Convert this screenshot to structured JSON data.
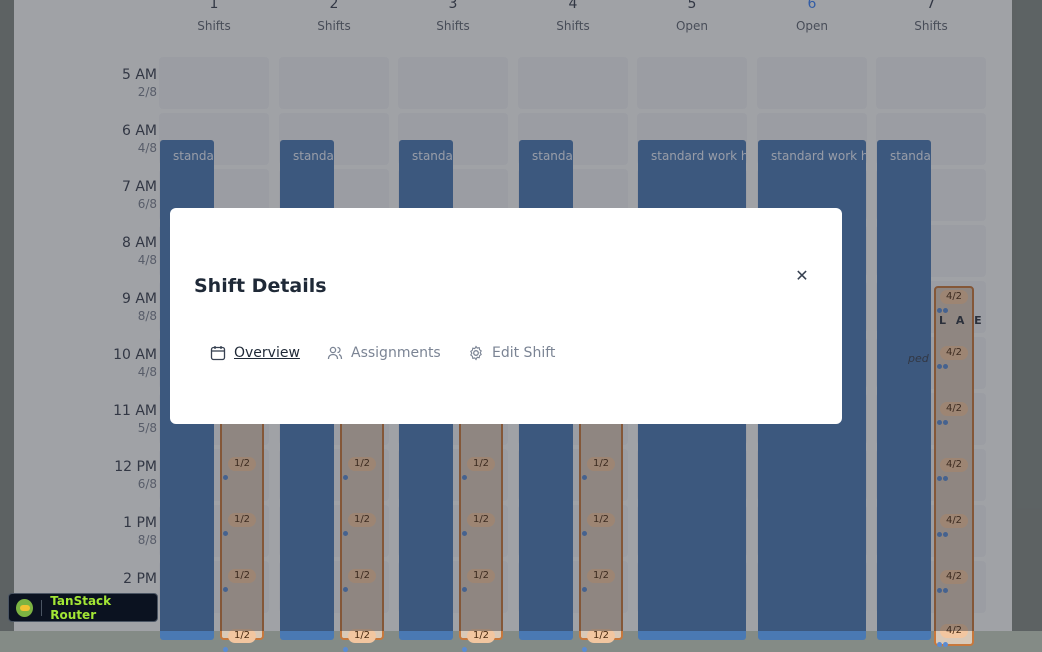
{
  "days": [
    {
      "num": "1",
      "sub": "Shifts",
      "today": false
    },
    {
      "num": "2",
      "sub": "Shifts",
      "today": false
    },
    {
      "num": "3",
      "sub": "Shifts",
      "today": false
    },
    {
      "num": "4",
      "sub": "Shifts",
      "today": false
    },
    {
      "num": "5",
      "sub": "Open",
      "today": false
    },
    {
      "num": "6",
      "sub": "Open",
      "today": true
    },
    {
      "num": "7",
      "sub": "Shifts",
      "today": false
    }
  ],
  "times": [
    {
      "time": "5 AM",
      "coverage": "2/8"
    },
    {
      "time": "6 AM",
      "coverage": "4/8"
    },
    {
      "time": "7 AM",
      "coverage": "6/8"
    },
    {
      "time": "8 AM",
      "coverage": "4/8"
    },
    {
      "time": "9 AM",
      "coverage": "8/8"
    },
    {
      "time": "10 AM",
      "coverage": "4/8"
    },
    {
      "time": "11 AM",
      "coverage": "5/8"
    },
    {
      "time": "12 PM",
      "coverage": "6/8"
    },
    {
      "time": "1 PM",
      "coverage": "8/8"
    },
    {
      "time": "2 PM",
      "coverage": ""
    }
  ],
  "shift_block": {
    "label_short": "standa",
    "label_long": "standard work he"
  },
  "sub_shift_count": "1/2",
  "day7_count": "4/2",
  "day7_fragment": "L A E",
  "day7_fragment2": "ped",
  "modal": {
    "title": "Shift Details",
    "close_icon": "close-icon",
    "tabs": [
      {
        "label": "Overview",
        "icon": "calendar-icon",
        "active": true
      },
      {
        "label": "Assignments",
        "icon": "users-icon",
        "active": false
      },
      {
        "label": "Edit Shift",
        "icon": "gear-icon",
        "active": false
      }
    ]
  },
  "devtools": {
    "label": "TanStack Router"
  },
  "colors": {
    "block": "#4a79b3",
    "accent": "#3b82f6",
    "chip": "#f2c6a0",
    "sub_border": "#c7783c"
  }
}
